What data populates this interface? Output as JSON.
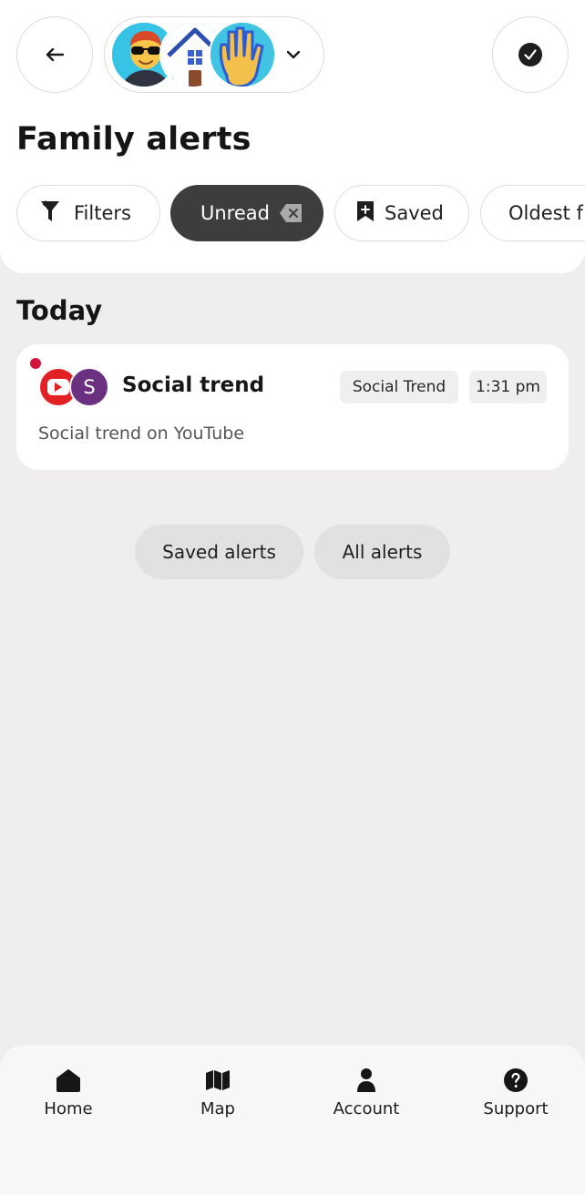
{
  "header": {
    "page_title": "Family alerts",
    "back_icon": "arrow-left-icon",
    "done_icon": "check-circle-icon",
    "members": [
      {
        "icon": "man-sunglasses-emoji"
      },
      {
        "icon": "house-emoji"
      },
      {
        "icon": "raised-hand-emoji"
      }
    ],
    "switcher_icon": "chevron-down-icon"
  },
  "filters": {
    "chips": [
      {
        "label": "Filters",
        "icon": "filter-icon"
      },
      {
        "label": "Unread",
        "icon": "clear-x-icon",
        "selected": true
      },
      {
        "label": "Saved",
        "icon": "bookmark-plus-icon"
      },
      {
        "label": "Oldest f"
      }
    ]
  },
  "sections": [
    {
      "heading": "Today",
      "alerts": [
        {
          "title": "Social trend",
          "category": "Social Trend",
          "time": "1:31 pm",
          "description": "Social trend on YouTube",
          "member_initial": "S",
          "app_icon": "youtube-icon",
          "unread": true
        }
      ]
    }
  ],
  "actions": {
    "saved_alerts": "Saved alerts",
    "all_alerts": "All alerts"
  },
  "bottom_nav": [
    {
      "label": "Home",
      "icon": "home-icon"
    },
    {
      "label": "Map",
      "icon": "map-icon"
    },
    {
      "label": "Account",
      "icon": "person-icon"
    },
    {
      "label": "Support",
      "icon": "question-icon"
    }
  ],
  "colors": {
    "background": "#efeeec",
    "card": "#ffffff",
    "chip_selected": "#3d3d3d",
    "unread_dot": "#d2133a",
    "member_avatar": "#6c3080",
    "youtube_red": "#e32124"
  }
}
